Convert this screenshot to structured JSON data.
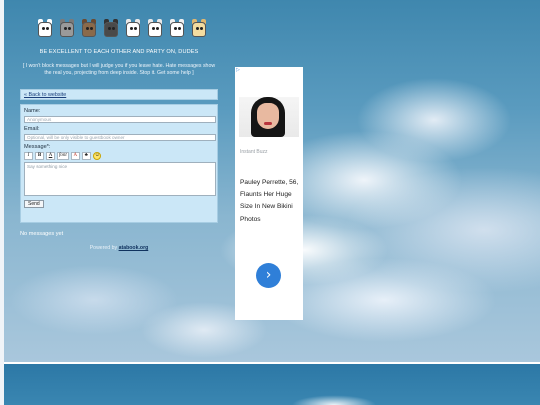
{
  "mascots": [
    {
      "name": "white",
      "color": "#ffffff",
      "ear": "#ffffff"
    },
    {
      "name": "gray",
      "color": "#9a9a9a",
      "ear": "#7a7a7a"
    },
    {
      "name": "brown",
      "color": "#8a6a4a",
      "ear": "#6a4a30"
    },
    {
      "name": "dark",
      "color": "#4a4a4a",
      "ear": "#333333"
    },
    {
      "name": "white",
      "color": "#ffffff",
      "ear": "#e8e8e8"
    },
    {
      "name": "white",
      "color": "#ffffff",
      "ear": "#e8e8e8"
    },
    {
      "name": "white",
      "color": "#ffffff",
      "ear": "#f0f0f0"
    },
    {
      "name": "cream",
      "color": "#f3dca0",
      "ear": "#e0b870"
    }
  ],
  "header": {
    "tagline": "BE EXCELLENT TO EACH OTHER AND PARTY ON, DUDES",
    "notice": "[ I won't block messages but I will judge you if you leave hate. Hate messages show the real you, projecting from deep inside. Stop it. Get some help ]"
  },
  "nav": {
    "back_link": "« Back to website"
  },
  "form": {
    "name_label": "Name:",
    "name_placeholder": "Anonymous",
    "email_label": "Email:",
    "email_placeholder": "Optional, will be only visible to guestbook owner",
    "message_label": "Message*:",
    "toolbar": {
      "italic": "I",
      "bold": "B",
      "underline": "A",
      "font": "font",
      "color": "A",
      "spoiler": "♣",
      "emoji": "☺"
    },
    "message_placeholder": "Say something nice",
    "send_label": "Send"
  },
  "messages": {
    "empty_text": "No messages yet"
  },
  "footer": {
    "powered_prefix": "Powered by",
    "powered_link": "atabook.org"
  },
  "ad": {
    "choices_icon": "ad-choices-icon",
    "source": "Instant Buzz",
    "headline": "Pauley Perrette, 56, Flaunts Her Huge Size In New Bikini Photos",
    "cta_icon": "chevron-right-icon"
  },
  "colors": {
    "panel_bg": "#cbe7f7",
    "link": "#1b3f7a",
    "cta": "#2f7fd8"
  }
}
